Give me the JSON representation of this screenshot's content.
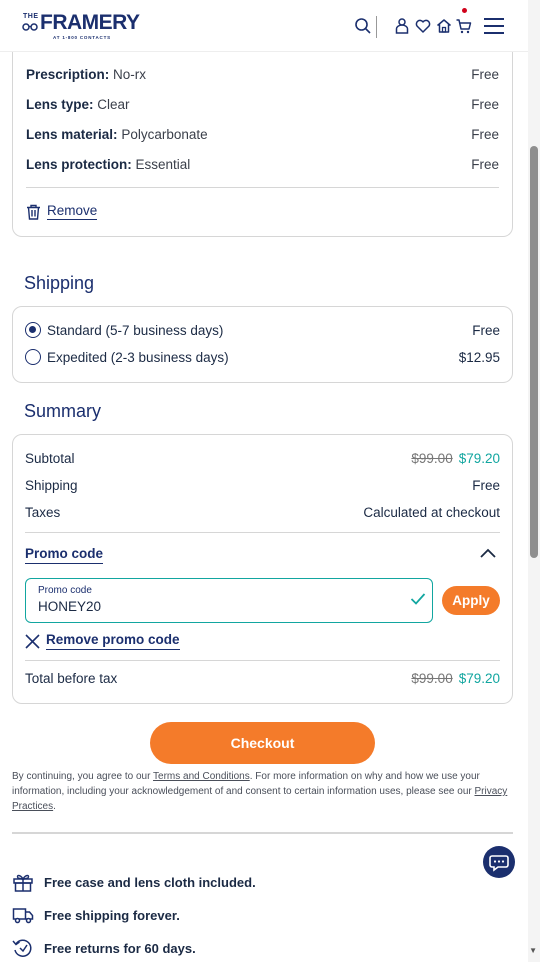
{
  "header": {
    "logo_the": "THE",
    "logo_brand": "FRAMERY",
    "logo_sub": "AT 1-800 CONTACTS"
  },
  "lens": {
    "rows": [
      {
        "key": "Prescription:",
        "value": "No-rx",
        "price": "Free"
      },
      {
        "key": "Lens type:",
        "value": "Clear",
        "price": "Free"
      },
      {
        "key": "Lens material:",
        "value": "Polycarbonate",
        "price": "Free"
      },
      {
        "key": "Lens protection:",
        "value": "Essential",
        "price": "Free"
      }
    ],
    "remove_label": "Remove"
  },
  "shipping": {
    "title": "Shipping",
    "options": [
      {
        "label": "Standard (5-7 business days)",
        "price": "Free",
        "selected": true
      },
      {
        "label": "Expedited (2-3 business days)",
        "price": "$12.95",
        "selected": false
      }
    ]
  },
  "summary": {
    "title": "Summary",
    "subtotal_label": "Subtotal",
    "subtotal_original": "$99.00",
    "subtotal_discounted": "$79.20",
    "shipping_label": "Shipping",
    "shipping_value": "Free",
    "taxes_label": "Taxes",
    "taxes_value": "Calculated at checkout",
    "promo_heading": "Promo code",
    "promo_field_label": "Promo code",
    "promo_value": "HONEY20",
    "apply_label": "Apply",
    "remove_promo_label": "Remove promo code",
    "total_label": "Total before tax",
    "total_original": "$99.00",
    "total_discounted": "$79.20"
  },
  "checkout_label": "Checkout",
  "legal": {
    "part1": "By continuing, you agree to our ",
    "terms": "Terms and Conditions",
    "part2": ". For more information on why and how we use your information, including your acknowledgement of and consent to certain information uses, please see our ",
    "privacy": "Privacy Practices",
    "part3": "."
  },
  "perks": [
    {
      "icon": "gift-icon",
      "text": "Free case and lens cloth included."
    },
    {
      "icon": "truck-icon",
      "text": "Free shipping forever."
    },
    {
      "icon": "returns-icon",
      "text": "Free returns for 60 days."
    }
  ],
  "colors": {
    "navy": "#1b2f6e",
    "orange": "#f47b2a",
    "teal": "#12a6a0"
  }
}
